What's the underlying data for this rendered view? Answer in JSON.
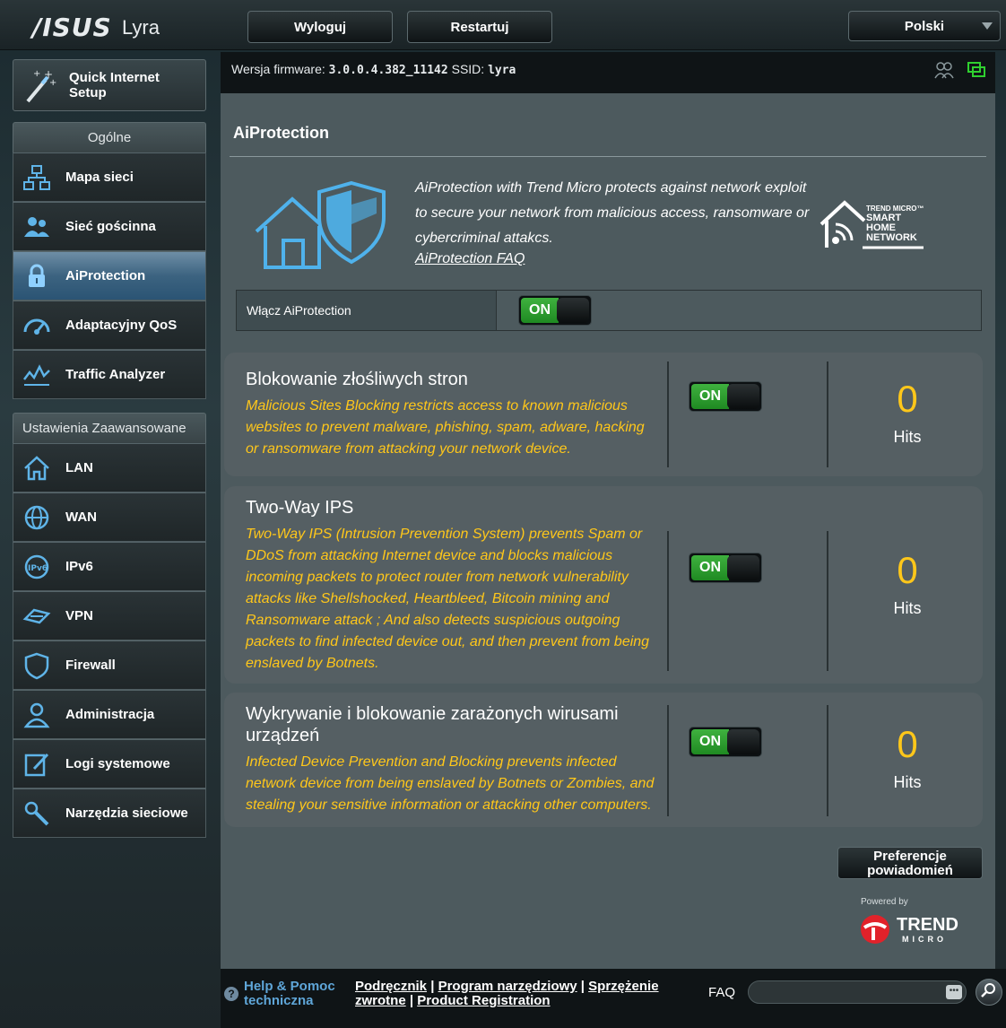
{
  "header": {
    "brand": "/ISUS",
    "model": "Lyra",
    "logout_label": "Wyloguj",
    "restart_label": "Restartuj",
    "language": "Polski"
  },
  "sidebar": {
    "qis_label_1": "Quick Internet",
    "qis_label_2": "Setup",
    "general_header": "Ogólne",
    "general_items": [
      {
        "label": "Mapa sieci",
        "icon": "network-map-icon"
      },
      {
        "label": "Sieć gościnna",
        "icon": "guest-network-icon"
      },
      {
        "label": "AiProtection",
        "icon": "lock-icon"
      },
      {
        "label": "Adaptacyjny QoS",
        "icon": "speedometer-icon"
      },
      {
        "label": "Traffic Analyzer",
        "icon": "traffic-chart-icon"
      }
    ],
    "advanced_header": "Ustawienia Zaawansowane",
    "advanced_items": [
      {
        "label": "LAN",
        "icon": "home-icon"
      },
      {
        "label": "WAN",
        "icon": "globe-icon"
      },
      {
        "label": "IPv6",
        "icon": "ipv6-icon"
      },
      {
        "label": "VPN",
        "icon": "vpn-icon"
      },
      {
        "label": "Firewall",
        "icon": "shield-icon"
      },
      {
        "label": "Administracja",
        "icon": "admin-user-icon"
      },
      {
        "label": "Logi systemowe",
        "icon": "log-edit-icon"
      },
      {
        "label": "Narzędzia sieciowe",
        "icon": "tools-icon"
      }
    ]
  },
  "infobar": {
    "firmware_label": "Wersja firmware:",
    "firmware_value": "3.0.0.4.382_11142",
    "ssid_label": "SSID:",
    "ssid_value": "lyra"
  },
  "main": {
    "title": "AiProtection",
    "intro_text": "AiProtection with Trend Micro protects against network exploit to secure your network from malicious access, ransomware or cybercriminal attakcs.",
    "faq_link": "AiProtection FAQ",
    "tm_logo_line1": "TREND MICRO™",
    "tm_logo_line2": "SMART",
    "tm_logo_line3": "HOME",
    "tm_logo_line4": "NETWORK",
    "enable_label": "Włącz AiProtection",
    "enable_state": "ON",
    "cards": [
      {
        "title": "Blokowanie złośliwych stron",
        "description": "Malicious Sites Blocking restricts access to known malicious websites to prevent malware, phishing, spam, adware, hacking or ransomware from attacking your network device.",
        "state": "ON",
        "hits": "0",
        "hits_label": "Hits"
      },
      {
        "title": "Two-Way IPS",
        "description": "Two-Way IPS (Intrusion Prevention System) prevents Spam or DDoS from attacking Internet device and blocks malicious incoming packets to protect router from network vulnerability attacks like Shellshocked, Heartbleed, Bitcoin mining and Ransomware attack ; And also detects suspicious outgoing packets to find infected device out, and then prevent from being enslaved by Botnets.",
        "state": "ON",
        "hits": "0",
        "hits_label": "Hits"
      },
      {
        "title": "Wykrywanie i blokowanie zarażonych wirusami urządzeń",
        "description": "Infected Device Prevention and Blocking prevents infected network device from being enslaved by Botnets or Zombies, and stealing your sensitive information or attacking other computers.",
        "state": "ON",
        "hits": "0",
        "hits_label": "Hits"
      }
    ],
    "pref_button_1": "Preferencje",
    "pref_button_2": "powiadomień",
    "powered_by": "Powered by",
    "trend_1": "TREND",
    "trend_2": "MICRO"
  },
  "footer": {
    "help_line1": "Help & Pomoc",
    "help_line2": "techniczna",
    "link_manual": "Podręcznik",
    "link_utility": "Program narzędziowy",
    "link_feedback": "Sprzężenie zwrotne",
    "link_registration": "Product Registration",
    "faq_label": "FAQ",
    "faq_dots": "•••"
  },
  "colors": {
    "accent_yellow": "#ffc71a",
    "toggle_green": "#2fa02f",
    "active_menu": "#3c6380"
  }
}
